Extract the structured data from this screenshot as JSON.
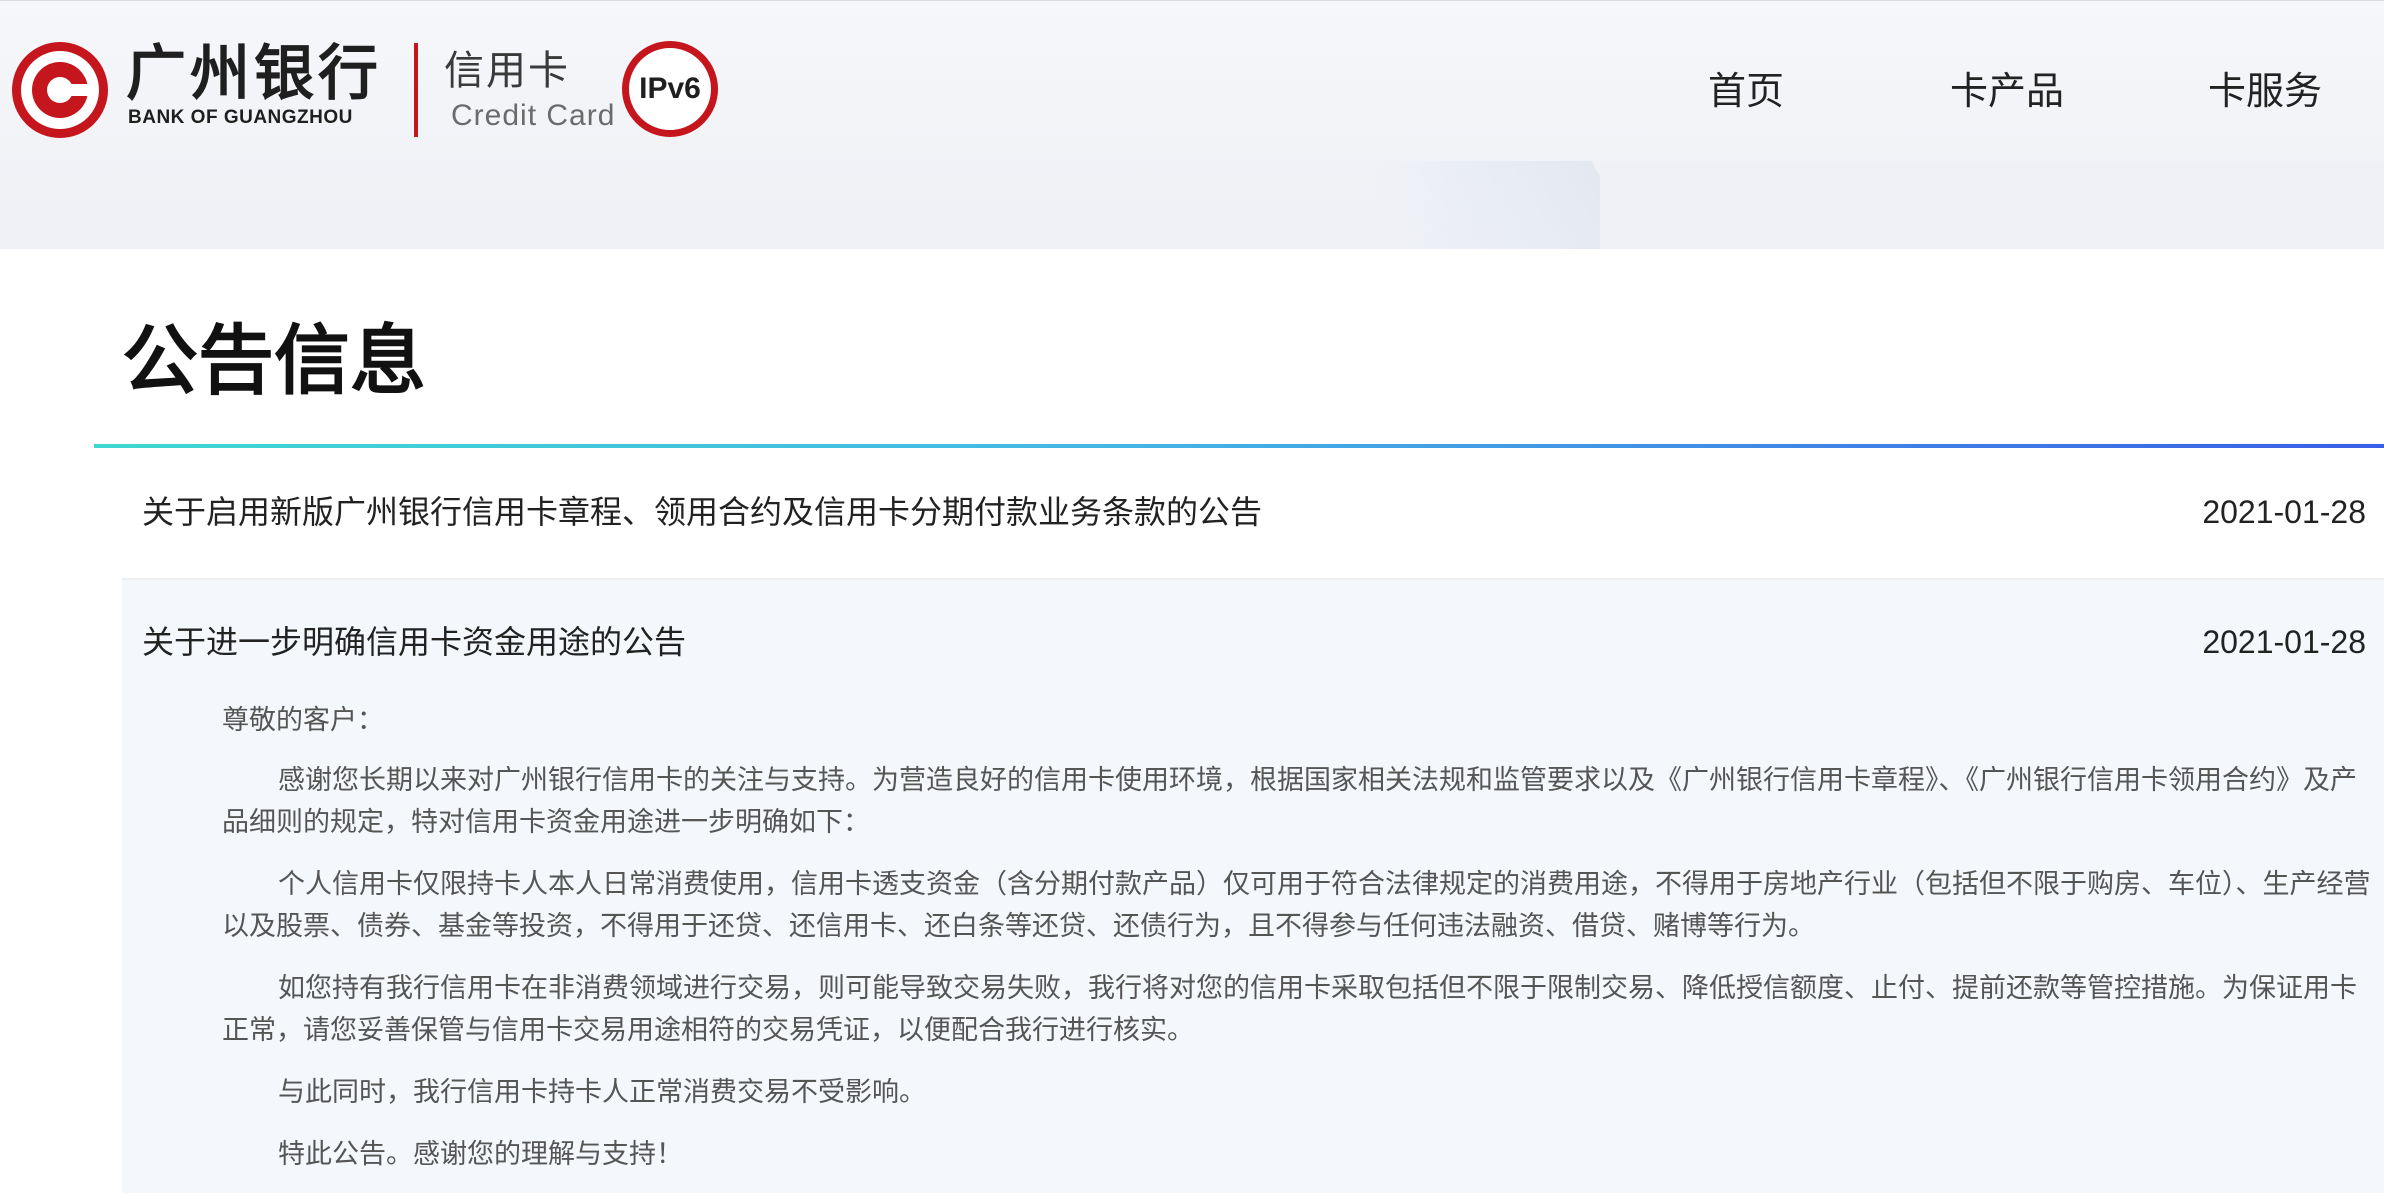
{
  "header": {
    "bank_name_cn": "广州银行",
    "bank_name_en": "BANK OF GUANGZHOU",
    "card_label_cn": "信用卡",
    "card_label_en": "Credit Card",
    "ipv6_badge": "IPv6",
    "brand_color": "#c4161c",
    "nav": [
      {
        "label": "首页"
      },
      {
        "label": "卡产品"
      },
      {
        "label": "卡服务"
      }
    ]
  },
  "main": {
    "page_title": "公告信息",
    "notices": [
      {
        "title": "关于启用新版广州银行信用卡章程、领用合约及信用卡分期付款业务条款的公告",
        "date": "2021-01-28"
      },
      {
        "title": "关于进一步明确信用卡资金用途的公告",
        "date": "2021-01-28",
        "expanded": true,
        "body": {
          "salutation": "尊敬的客户：",
          "paragraphs": [
            "感谢您长期以来对广州银行信用卡的关注与支持。为营造良好的信用卡使用环境，根据国家相关法规和监管要求以及《广州银行信用卡章程》、《广州银行信用卡领用合约》及产品细则的规定，特对信用卡资金用途进一步明确如下：",
            "个人信用卡仅限持卡人本人日常消费使用，信用卡透支资金（含分期付款产品）仅可用于符合法律规定的消费用途，不得用于房地产行业（包括但不限于购房、车位）、生产经营以及股票、债券、基金等投资，不得用于还贷、还信用卡、还白条等还贷、还债行为，且不得参与任何违法融资、借贷、赌博等行为。",
            "如您持有我行信用卡在非消费领域进行交易，则可能导致交易失败，我行将对您的信用卡采取包括但不限于限制交易、降低授信额度、止付、提前还款等管控措施。为保证用卡正常，请您妥善保管与信用卡交易用途相符的交易凭证，以便配合我行进行核实。",
            "与此同时，我行信用卡持卡人正常消费交易不受影响。",
            "特此公告。感谢您的理解与支持！"
          ]
        }
      }
    ]
  }
}
